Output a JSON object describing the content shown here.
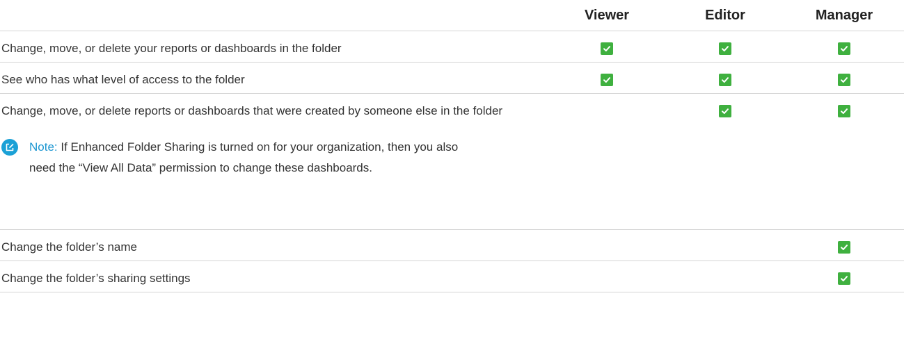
{
  "colors": {
    "check_green": "#3fb03f",
    "note_blue": "#1ba1d6",
    "note_label": "#1b96d1",
    "divider": "#d4d4d4"
  },
  "headers": {
    "viewer": "Viewer",
    "editor": "Editor",
    "manager": "Manager"
  },
  "rows": [
    {
      "label": "Change, move, or delete your reports or dashboards in the folder",
      "viewer": true,
      "editor": true,
      "manager": true
    },
    {
      "label": "See who has what level of access to the folder",
      "viewer": true,
      "editor": true,
      "manager": true
    },
    {
      "label": "Change, move, or delete reports or dashboards that were created by someone else in the folder",
      "note_label": "Note:",
      "note_text": "If Enhanced Folder Sharing is turned on for your organization, then you also need the “View All Data” permission to change these dashboards.",
      "note_icon": "note-edit-icon",
      "viewer": false,
      "editor": true,
      "manager": true
    },
    {
      "label": "Change the folder’s name",
      "viewer": false,
      "editor": false,
      "manager": true
    },
    {
      "label": "Change the folder’s sharing settings",
      "viewer": false,
      "editor": false,
      "manager": true
    }
  ],
  "icons": {
    "check": "checkmark-icon"
  }
}
